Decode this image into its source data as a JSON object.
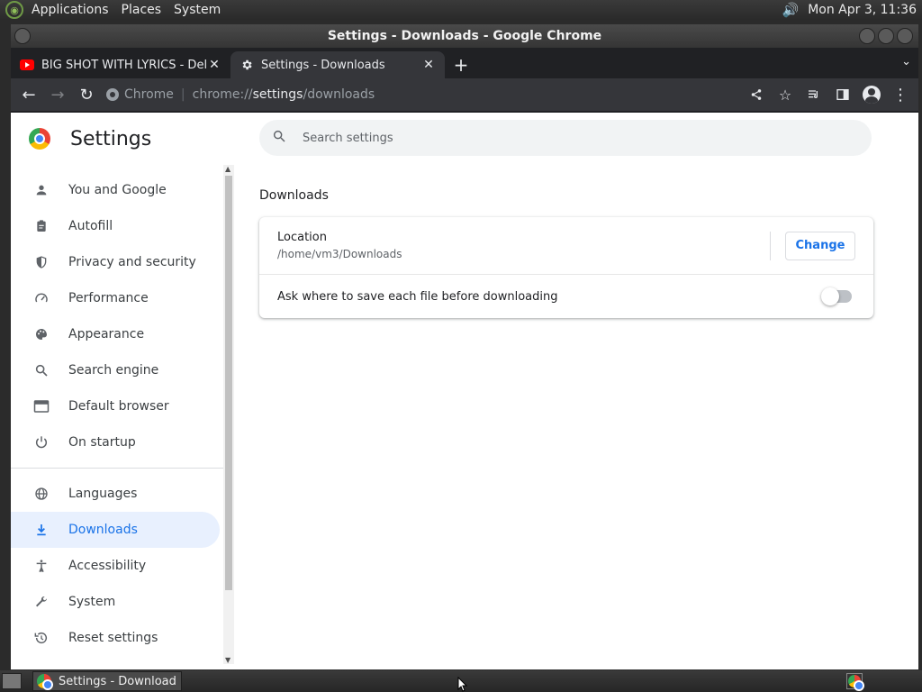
{
  "top_panel": {
    "menus": [
      "Applications",
      "Places",
      "System"
    ],
    "clock": "Mon Apr  3, 11:36"
  },
  "window": {
    "title": "Settings - Downloads - Google Chrome"
  },
  "tabs": [
    {
      "title": "BIG SHOT WITH LYRICS - Deltarune",
      "favicon": "youtube-icon",
      "active": false
    },
    {
      "title": "Settings - Downloads",
      "favicon": "gear-icon",
      "active": true
    }
  ],
  "toolbar": {
    "site_label": "Chrome",
    "url_dim_prefix": "chrome://",
    "url_highlight": "settings",
    "url_dim_suffix": "/downloads"
  },
  "settings": {
    "title": "Settings",
    "search_placeholder": "Search settings",
    "nav": [
      {
        "label": "You and Google",
        "icon": "person-icon"
      },
      {
        "label": "Autofill",
        "icon": "clipboard-icon"
      },
      {
        "label": "Privacy and security",
        "icon": "shield-icon"
      },
      {
        "label": "Performance",
        "icon": "speedometer-icon"
      },
      {
        "label": "Appearance",
        "icon": "palette-icon"
      },
      {
        "label": "Search engine",
        "icon": "search-icon"
      },
      {
        "label": "Default browser",
        "icon": "browser-window-icon"
      },
      {
        "label": "On startup",
        "icon": "power-icon"
      },
      {
        "label": "Languages",
        "icon": "globe-icon"
      },
      {
        "label": "Downloads",
        "icon": "download-icon",
        "selected": true
      },
      {
        "label": "Accessibility",
        "icon": "accessibility-icon"
      },
      {
        "label": "System",
        "icon": "wrench-icon"
      },
      {
        "label": "Reset settings",
        "icon": "history-icon"
      }
    ],
    "section_title": "Downloads",
    "location_label": "Location",
    "location_value": "/home/vm3/Downloads",
    "change_label": "Change",
    "ask_label": "Ask where to save each file before downloading",
    "ask_enabled": false
  },
  "taskbar": {
    "task_title": "Settings - Download..."
  },
  "colors": {
    "accent": "#1a73e8",
    "selected_bg": "#e8f0fe",
    "tab_active": "#35363a",
    "tab_strip": "#202124"
  }
}
